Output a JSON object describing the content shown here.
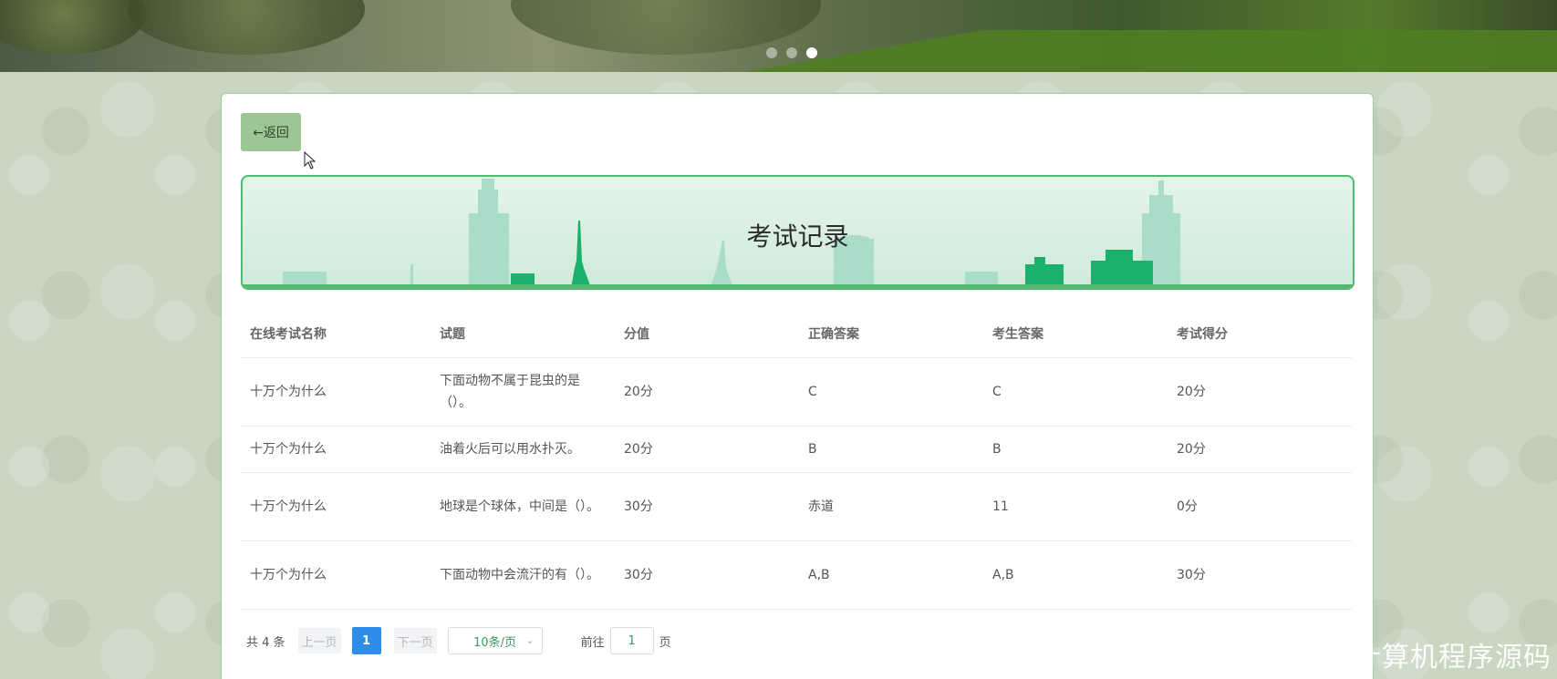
{
  "banner": {
    "slides": 3,
    "active_slide": 3
  },
  "back_button": {
    "label": "←返回"
  },
  "page_title": "考试记录",
  "table": {
    "headers": [
      "在线考试名称",
      "试题",
      "分值",
      "正确答案",
      "考生答案",
      "考试得分"
    ],
    "rows": [
      [
        "十万个为什么",
        "下面动物不属于昆虫的是（）。",
        "20分",
        "C",
        "C",
        "20分"
      ],
      [
        "十万个为什么",
        "油着火后可以用水扑灭。",
        "20分",
        "B",
        "B",
        "20分"
      ],
      [
        "十万个为什么",
        "地球是个球体，中间是（）。",
        "30分",
        "赤道",
        "11",
        "0分"
      ],
      [
        "十万个为什么",
        "下面动物中会流汗的有（）。",
        "30分",
        "A,B",
        "A,B",
        "30分"
      ]
    ]
  },
  "pagination": {
    "total": "共 4 条",
    "prev": "上一页",
    "current": "1",
    "next": "下一页",
    "page_size": "10条/页",
    "goto_label": "前往",
    "goto_value": "1",
    "page_label": "页"
  },
  "watermark": "CSDN @计算机程序源码",
  "colors": {
    "accent_green": "#54b870",
    "back_button_bg": "#9cc795",
    "current_page_blue": "#2e8de6"
  }
}
